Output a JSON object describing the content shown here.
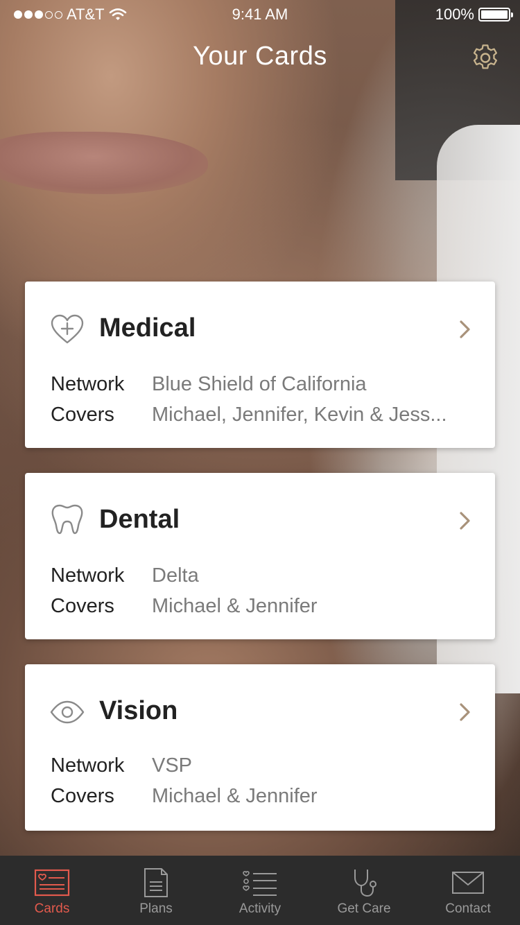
{
  "status_bar": {
    "carrier": "AT&T",
    "time": "9:41 AM",
    "battery": "100%"
  },
  "header": {
    "title": "Your Cards",
    "settings_icon": "gear-icon"
  },
  "cards": [
    {
      "name": "Medical",
      "icon": "heart-plus-icon",
      "network_label": "Network",
      "network": "Blue Shield of California",
      "covers_label": "Covers",
      "covers": "Michael, Jennifer, Kevin & Jess..."
    },
    {
      "name": "Dental",
      "icon": "tooth-icon",
      "network_label": "Network",
      "network": "Delta",
      "covers_label": "Covers",
      "covers": "Michael & Jennifer"
    },
    {
      "name": "Vision",
      "icon": "eye-icon",
      "network_label": "Network",
      "network": "VSP",
      "covers_label": "Covers",
      "covers": "Michael & Jennifer"
    }
  ],
  "tabbar": {
    "items": [
      {
        "label": "Cards",
        "icon": "id-card-icon",
        "active": true
      },
      {
        "label": "Plans",
        "icon": "document-icon",
        "active": false
      },
      {
        "label": "Activity",
        "icon": "activity-list-icon",
        "active": false
      },
      {
        "label": "Get Care",
        "icon": "stethoscope-icon",
        "active": false
      },
      {
        "label": "Contact",
        "icon": "envelope-icon",
        "active": false
      }
    ]
  },
  "colors": {
    "accent": "#e35a4d",
    "chevron": "#a8927a",
    "settings_icon": "#c8b48e",
    "tabbar_bg": "#2c2c2c",
    "tab_inactive": "#9a9a9a"
  }
}
